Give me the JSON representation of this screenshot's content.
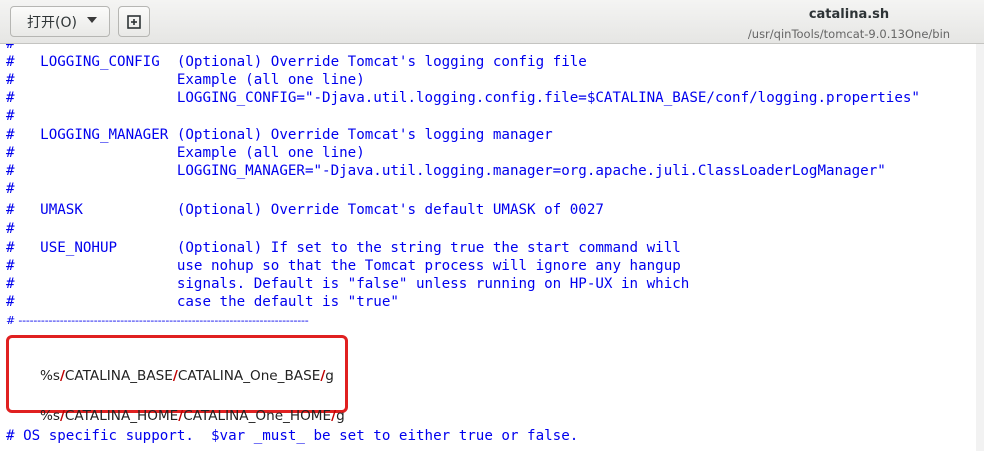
{
  "header": {
    "open_button_label": "打开(O)",
    "title": "catalina.sh",
    "path": "/usr/qinTools/tomcat-9.0.13One/bin"
  },
  "icons": {
    "open_dropdown": "chevron-down-icon",
    "new_document": "new-document-icon"
  },
  "editor": {
    "comment_lines": [
      "#   LOGGING_CONFIG  (Optional) Override Tomcat's logging config file",
      "#                   Example (all one line)",
      "#                   LOGGING_CONFIG=\"-Djava.util.logging.config.file=$CATALINA_BASE/conf/logging.properties\"",
      "#",
      "#   LOGGING_MANAGER (Optional) Override Tomcat's logging manager",
      "#                   Example (all one line)",
      "#                   LOGGING_MANAGER=\"-Djava.util.logging.manager=org.apache.juli.ClassLoaderLogManager\"",
      "#",
      "#   UMASK           (Optional) Override Tomcat's default UMASK of 0027",
      "#",
      "#   USE_NOHUP       (Optional) If set to the string true the start command will",
      "#                   use nohup so that the Tomcat process will ignore any hangup",
      "#                   signals. Default is \"false\" unless running on HP-UX in which",
      "#                   case the default is \"true\""
    ],
    "top_partial": "#",
    "separator": "# -----------------------------------------------------------------------------",
    "sed_commands": [
      {
        "prefix": "%s",
        "find": "CATALINA_BASE",
        "replace": "CATALINA_One_BASE",
        "flag": "g"
      },
      {
        "prefix": "%s",
        "find": "CATALINA_HOME",
        "replace": "CATALINA_One_HOME",
        "flag": "g"
      }
    ],
    "slash": "/",
    "after_line": "# OS specific support.  $var _must_ be set to either true or false."
  },
  "colors": {
    "comment": "#0000ee",
    "highlight_box": "#e02020",
    "slash": "#c00000"
  }
}
